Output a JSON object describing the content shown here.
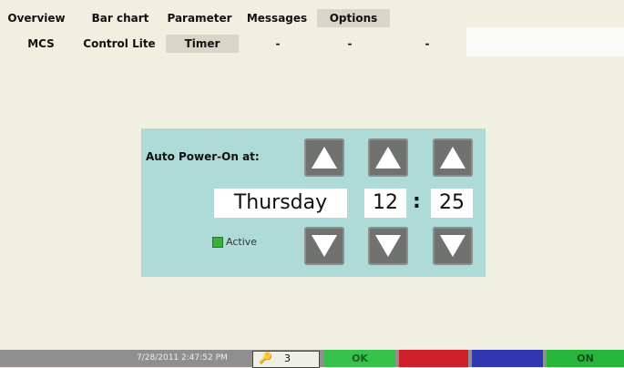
{
  "top_tabs": [
    "Overview",
    "Bar chart",
    "Parameter",
    "Messages",
    "Options"
  ],
  "sub_tabs": [
    "MCS",
    "Control Lite",
    "Timer",
    "-",
    "-",
    "-"
  ],
  "panel": {
    "label": "Auto Power-On at:",
    "day": "Thursday",
    "hour": "12",
    "colon": ":",
    "minute": "25",
    "active_label": "Active"
  },
  "status": {
    "timestamp": "7/28/2011 2:47:52 PM",
    "key_count": "3",
    "ok_label": "OK",
    "on_label": "ON"
  },
  "colors": {
    "panel": "#aedbd8",
    "ok_green": "#37c24b",
    "red": "#d0202a",
    "blue": "#2f38b0",
    "on_green": "#27b53a",
    "active_indicator": "#3cae40"
  },
  "icons": [
    "up-arrow-icon",
    "down-arrow-icon",
    "key-icon"
  ]
}
